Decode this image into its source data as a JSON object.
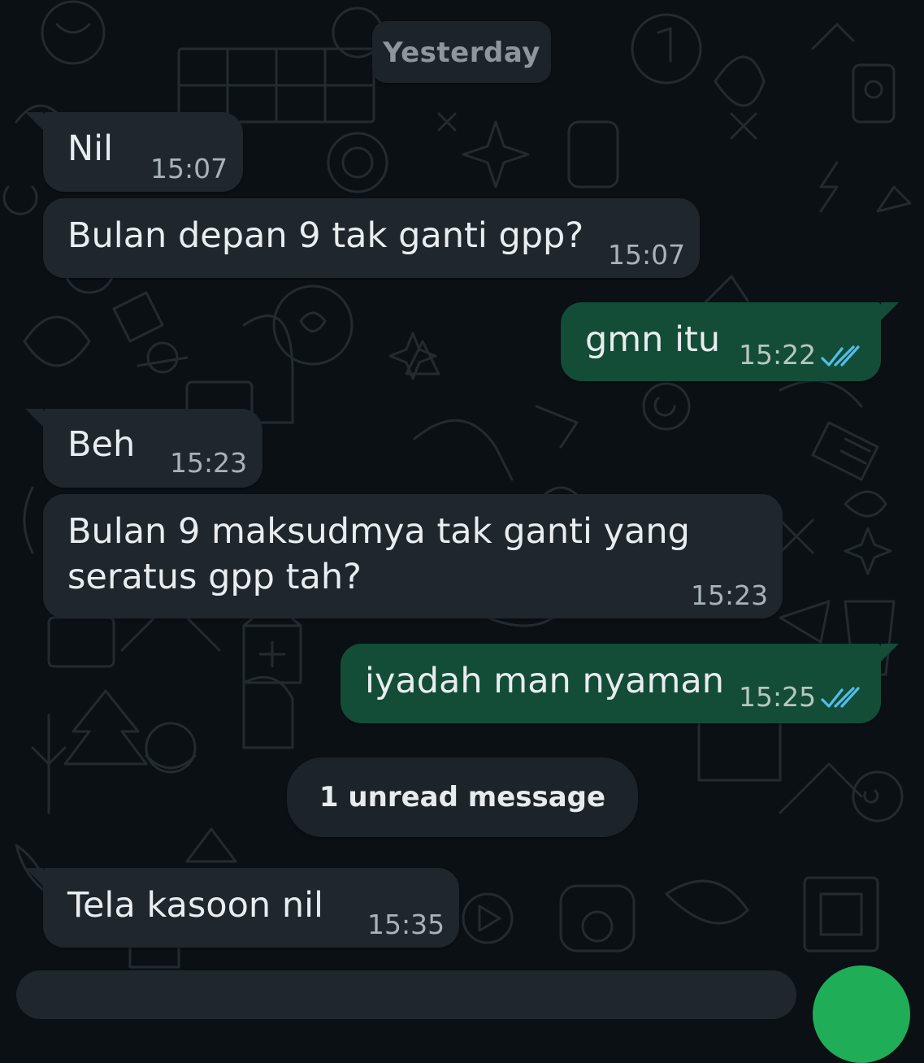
{
  "date_separator": "Yesterday",
  "unread_separator": "1 unread message",
  "messages": [
    {
      "direction": "incoming",
      "text": "Nil",
      "time": "15:07"
    },
    {
      "direction": "incoming",
      "text": "Bulan depan 9 tak ganti gpp?",
      "time": "15:07"
    },
    {
      "direction": "outgoing",
      "text": "gmn itu",
      "time": "15:22",
      "status": "read"
    },
    {
      "direction": "incoming",
      "text": "Beh",
      "time": "15:23"
    },
    {
      "direction": "incoming",
      "text_line1": "Bulan 9 maksudmya tak ganti yang",
      "text_line2": "seratus gpp tah?",
      "time": "15:23"
    },
    {
      "direction": "outgoing",
      "text": "iyadah man nyaman",
      "time": "15:25",
      "status": "read"
    },
    {
      "direction": "incoming",
      "text": "Tela kasoon nil",
      "time": "15:35"
    }
  ],
  "icons": {
    "read_receipt": "double-check-icon",
    "wallpaper": "doodle-pattern"
  },
  "colors": {
    "background": "#0b1014",
    "incoming_bubble": "#1f272c",
    "outgoing_bubble": "#134d37",
    "read_ticks": "#53bdeb",
    "text": "#e9edef",
    "meta_text": "#a8b3b9"
  }
}
